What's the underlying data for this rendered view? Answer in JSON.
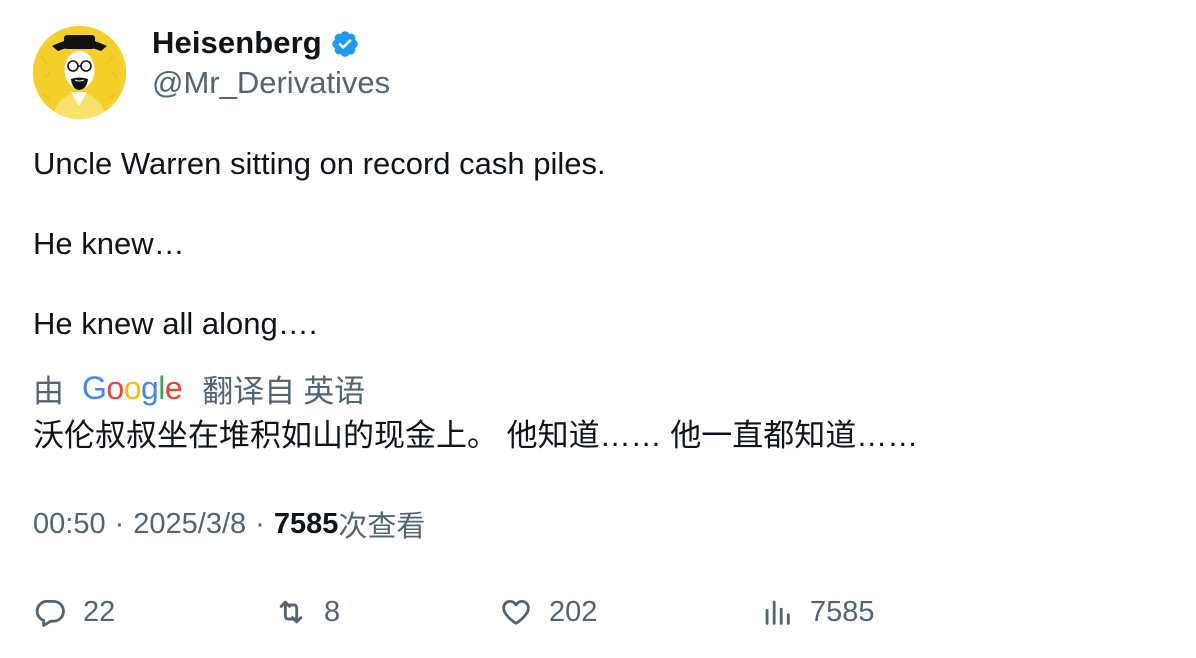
{
  "author": {
    "display_name": "Heisenberg",
    "handle": "@Mr_Derivatives",
    "verified": true,
    "verified_color": "#1d9bf0",
    "avatar_icon": "heisenberg-avatar-icon",
    "avatar_color": "#f5cf2a"
  },
  "tweet": {
    "lines": [
      "Uncle Warren sitting on record cash piles.",
      "He knew…",
      "He knew all along…."
    ]
  },
  "translation": {
    "by_label": "由",
    "provider": "Google",
    "from_label": "翻译自",
    "language": "英语",
    "text": "沃伦叔叔坐在堆积如山的现金上。 他知道…… 他一直都知道……"
  },
  "meta": {
    "time": "00:50",
    "date": "2025/3/8",
    "separator": "·",
    "views_count": "7585",
    "views_label": "次查看"
  },
  "actions": {
    "reply": {
      "icon": "reply-icon",
      "count": "22"
    },
    "retweet": {
      "icon": "retweet-icon",
      "count": "8"
    },
    "like": {
      "icon": "heart-icon",
      "count": "202"
    },
    "views": {
      "icon": "analytics-icon",
      "count": "7585"
    }
  }
}
